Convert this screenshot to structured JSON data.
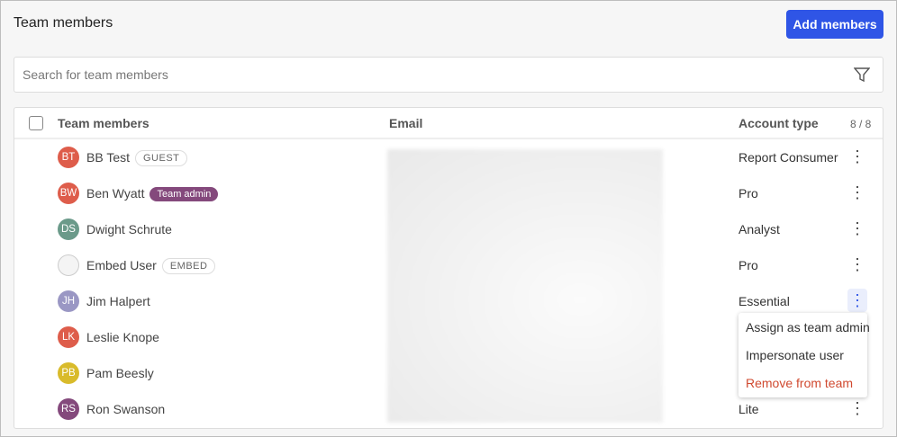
{
  "header": {
    "title": "Team members",
    "add_label": "Add members"
  },
  "search": {
    "placeholder": "Search for team members"
  },
  "table": {
    "col_members": "Team members",
    "col_email": "Email",
    "col_account": "Account type",
    "count": "8 / 8",
    "rows": [
      {
        "initials": "BT",
        "name": "BB Test",
        "badge": "GUEST",
        "color": "#de5d4b",
        "account": "Report Consumer"
      },
      {
        "initials": "BW",
        "name": "Ben Wyatt",
        "badge": "Team admin",
        "color": "#de5d4b",
        "account": "Pro"
      },
      {
        "initials": "DS",
        "name": "Dwight Schrute",
        "color": "#6b9a8a",
        "account": "Analyst"
      },
      {
        "initials": "",
        "name": "Embed User",
        "badge": "EMBED",
        "color": "#f4f4f4",
        "account": "Pro"
      },
      {
        "initials": "JH",
        "name": "Jim Halpert",
        "color": "#9a97c4",
        "account": "Essential"
      },
      {
        "initials": "LK",
        "name": "Leslie Knope",
        "color": "#de5d4b",
        "account": ""
      },
      {
        "initials": "PB",
        "name": "Pam Beesly",
        "color": "#d9bb2b",
        "account": ""
      },
      {
        "initials": "RS",
        "name": "Ron Swanson",
        "color": "#84497c",
        "account": "Lite"
      }
    ]
  },
  "menu": {
    "items": [
      "Assign as team admin",
      "Impersonate user",
      "Remove from team"
    ],
    "danger_color": "#d0492f"
  }
}
